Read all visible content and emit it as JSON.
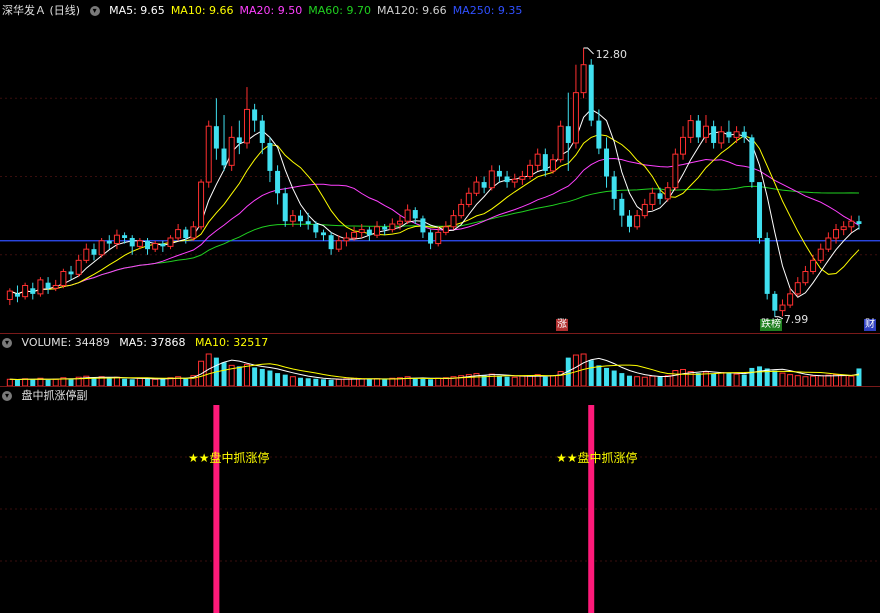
{
  "main": {
    "title": "深华发Ａ (日线)",
    "ma_labels": [
      {
        "text": "MA5: 9.65",
        "color": "#ffffff"
      },
      {
        "text": "MA10: 9.66",
        "color": "#ffff00"
      },
      {
        "text": "MA20: 9.50",
        "color": "#ff40ff"
      },
      {
        "text": "MA60: 9.70",
        "color": "#20d020"
      },
      {
        "text": "MA120: 9.66",
        "color": "#d0d0d0"
      },
      {
        "text": "MA250: 9.35",
        "color": "#3050ff"
      }
    ],
    "high_label": "12.80",
    "low_label": "7.99",
    "markers": [
      {
        "text": "涨",
        "color": "#b03030"
      },
      {
        "text": "跌榜",
        "color": "#208020"
      },
      {
        "text": "财",
        "color": "#3040c0"
      }
    ]
  },
  "volume": {
    "title": "VOLUME: 34489",
    "ma5": "MA5: 37868",
    "ma10": "MA10: 32517"
  },
  "indicator": {
    "title": "盘中抓涨停副",
    "signal_label": "★★盘中抓涨停"
  },
  "colors": {
    "up": "#ff3030",
    "down": "#40e0f0",
    "ma5": "#ffffff",
    "ma10": "#ffff00",
    "ma20": "#ff40ff",
    "ma60": "#20d020",
    "ma120": "#d0d0d0",
    "ma250": "#3050ff",
    "signal": "#ff1a7a"
  },
  "chart_data": {
    "type": "candlestick",
    "title": "深华发Ａ (日线)",
    "price_range": [
      7.7,
      13.3
    ],
    "extremes": {
      "high": 12.8,
      "low": 7.99
    },
    "candles": [
      [
        8.3,
        8.45,
        8.2,
        8.5
      ],
      [
        8.4,
        8.35,
        8.25,
        8.55
      ],
      [
        8.35,
        8.55,
        8.3,
        8.6
      ],
      [
        8.5,
        8.4,
        8.3,
        8.6
      ],
      [
        8.4,
        8.65,
        8.35,
        8.7
      ],
      [
        8.6,
        8.5,
        8.4,
        8.7
      ],
      [
        8.5,
        8.55,
        8.45,
        8.65
      ],
      [
        8.55,
        8.8,
        8.5,
        8.85
      ],
      [
        8.8,
        8.75,
        8.65,
        8.9
      ],
      [
        8.75,
        9.0,
        8.7,
        9.1
      ],
      [
        9.0,
        9.2,
        8.95,
        9.3
      ],
      [
        9.2,
        9.1,
        9.0,
        9.3
      ],
      [
        9.1,
        9.35,
        9.05,
        9.4
      ],
      [
        9.35,
        9.3,
        9.2,
        9.45
      ],
      [
        9.3,
        9.45,
        9.2,
        9.55
      ],
      [
        9.45,
        9.4,
        9.3,
        9.5
      ],
      [
        9.4,
        9.25,
        9.1,
        9.45
      ],
      [
        9.25,
        9.35,
        9.2,
        9.4
      ],
      [
        9.35,
        9.2,
        9.1,
        9.4
      ],
      [
        9.2,
        9.3,
        9.15,
        9.35
      ],
      [
        9.3,
        9.25,
        9.15,
        9.35
      ],
      [
        9.25,
        9.4,
        9.2,
        9.45
      ],
      [
        9.4,
        9.55,
        9.35,
        9.65
      ],
      [
        9.55,
        9.4,
        9.3,
        9.6
      ],
      [
        9.4,
        9.6,
        9.35,
        9.7
      ],
      [
        9.6,
        10.4,
        9.55,
        10.45
      ],
      [
        10.4,
        11.4,
        10.3,
        11.5
      ],
      [
        11.4,
        11.0,
        10.8,
        11.9
      ],
      [
        11.0,
        10.7,
        10.6,
        11.6
      ],
      [
        10.7,
        11.2,
        10.6,
        11.4
      ],
      [
        11.2,
        11.1,
        10.9,
        11.5
      ],
      [
        11.1,
        11.7,
        11.0,
        12.1
      ],
      [
        11.7,
        11.5,
        11.3,
        11.8
      ],
      [
        11.5,
        11.1,
        10.9,
        11.6
      ],
      [
        11.1,
        10.6,
        10.4,
        11.2
      ],
      [
        10.6,
        10.2,
        10.0,
        10.7
      ],
      [
        10.2,
        9.7,
        9.6,
        10.3
      ],
      [
        9.7,
        9.8,
        9.6,
        9.9
      ],
      [
        9.8,
        9.7,
        9.6,
        9.9
      ],
      [
        9.7,
        9.65,
        9.55,
        9.85
      ],
      [
        9.65,
        9.5,
        9.4,
        9.7
      ],
      [
        9.5,
        9.45,
        9.35,
        9.55
      ],
      [
        9.45,
        9.2,
        9.1,
        9.5
      ],
      [
        9.2,
        9.35,
        9.15,
        9.45
      ],
      [
        9.35,
        9.4,
        9.25,
        9.5
      ],
      [
        9.4,
        9.5,
        9.35,
        9.6
      ],
      [
        9.5,
        9.55,
        9.4,
        9.65
      ],
      [
        9.55,
        9.45,
        9.35,
        9.6
      ],
      [
        9.45,
        9.6,
        9.4,
        9.7
      ],
      [
        9.6,
        9.55,
        9.45,
        9.65
      ],
      [
        9.55,
        9.65,
        9.5,
        9.75
      ],
      [
        9.65,
        9.7,
        9.55,
        9.8
      ],
      [
        9.7,
        9.9,
        9.65,
        10.0
      ],
      [
        9.9,
        9.75,
        9.65,
        9.95
      ],
      [
        9.75,
        9.5,
        9.4,
        9.8
      ],
      [
        9.5,
        9.3,
        9.2,
        9.55
      ],
      [
        9.3,
        9.5,
        9.25,
        9.6
      ],
      [
        9.5,
        9.6,
        9.45,
        9.7
      ],
      [
        9.6,
        9.8,
        9.55,
        9.9
      ],
      [
        9.8,
        10.0,
        9.75,
        10.1
      ],
      [
        10.0,
        10.2,
        9.95,
        10.3
      ],
      [
        10.2,
        10.4,
        10.15,
        10.5
      ],
      [
        10.4,
        10.3,
        10.2,
        10.5
      ],
      [
        10.3,
        10.6,
        10.25,
        10.7
      ],
      [
        10.6,
        10.5,
        10.4,
        10.7
      ],
      [
        10.5,
        10.4,
        10.3,
        10.6
      ],
      [
        10.4,
        10.45,
        10.3,
        10.55
      ],
      [
        10.45,
        10.5,
        10.35,
        10.6
      ],
      [
        10.5,
        10.7,
        10.45,
        10.8
      ],
      [
        10.7,
        10.9,
        10.6,
        11.0
      ],
      [
        10.9,
        10.6,
        10.5,
        11.0
      ],
      [
        10.6,
        10.8,
        10.55,
        10.9
      ],
      [
        10.8,
        11.4,
        10.75,
        11.5
      ],
      [
        11.4,
        11.1,
        10.6,
        12.0
      ],
      [
        11.1,
        12.0,
        11.0,
        12.5
      ],
      [
        12.0,
        12.5,
        11.9,
        12.8
      ],
      [
        12.5,
        11.5,
        11.4,
        12.6
      ],
      [
        11.5,
        11.0,
        10.9,
        11.7
      ],
      [
        11.0,
        10.5,
        10.3,
        11.2
      ],
      [
        10.5,
        10.1,
        9.9,
        10.6
      ],
      [
        10.1,
        9.8,
        9.6,
        10.2
      ],
      [
        9.8,
        9.6,
        9.5,
        9.9
      ],
      [
        9.6,
        9.8,
        9.55,
        9.9
      ],
      [
        9.8,
        10.0,
        9.75,
        10.1
      ],
      [
        10.0,
        10.2,
        9.9,
        10.3
      ],
      [
        10.2,
        10.1,
        10.0,
        10.3
      ],
      [
        10.1,
        10.3,
        10.05,
        10.4
      ],
      [
        10.3,
        10.9,
        10.25,
        11.0
      ],
      [
        10.9,
        11.2,
        10.8,
        11.4
      ],
      [
        11.2,
        11.5,
        11.1,
        11.6
      ],
      [
        11.5,
        11.2,
        11.1,
        11.6
      ],
      [
        11.2,
        11.4,
        11.1,
        11.6
      ],
      [
        11.4,
        11.1,
        11.0,
        11.5
      ],
      [
        11.1,
        11.3,
        11.0,
        11.4
      ],
      [
        11.3,
        11.2,
        11.1,
        11.5
      ],
      [
        11.2,
        11.3,
        11.1,
        11.4
      ],
      [
        11.3,
        11.2,
        11.1,
        11.4
      ],
      [
        11.2,
        10.4,
        10.3,
        11.25
      ],
      [
        10.4,
        9.4,
        9.3,
        10.0
      ],
      [
        9.4,
        8.4,
        8.3,
        9.5
      ],
      [
        8.4,
        8.1,
        7.99,
        8.45
      ],
      [
        8.1,
        8.2,
        8.0,
        8.3
      ],
      [
        8.2,
        8.4,
        8.15,
        8.5
      ],
      [
        8.4,
        8.6,
        8.35,
        8.7
      ],
      [
        8.6,
        8.8,
        8.55,
        8.9
      ],
      [
        8.8,
        9.0,
        8.75,
        9.1
      ],
      [
        9.0,
        9.2,
        8.95,
        9.3
      ],
      [
        9.2,
        9.4,
        9.15,
        9.5
      ],
      [
        9.4,
        9.55,
        9.3,
        9.65
      ],
      [
        9.55,
        9.6,
        9.45,
        9.7
      ],
      [
        9.6,
        9.7,
        9.5,
        9.8
      ],
      [
        9.7,
        9.65,
        9.55,
        9.8
      ]
    ],
    "volume": [
      13,
      12,
      14,
      13,
      15,
      12,
      13,
      16,
      14,
      17,
      19,
      16,
      18,
      15,
      17,
      14,
      13,
      15,
      14,
      13,
      14,
      16,
      18,
      15,
      20,
      48,
      62,
      55,
      46,
      40,
      38,
      42,
      36,
      33,
      30,
      25,
      22,
      18,
      16,
      15,
      14,
      13,
      12,
      13,
      14,
      15,
      14,
      13,
      14,
      13,
      15,
      16,
      18,
      15,
      14,
      13,
      15,
      16,
      18,
      20,
      22,
      24,
      21,
      23,
      20,
      18,
      17,
      19,
      20,
      22,
      18,
      20,
      28,
      55,
      60,
      62,
      50,
      40,
      35,
      30,
      25,
      20,
      18,
      17,
      19,
      18,
      20,
      30,
      32,
      28,
      25,
      27,
      24,
      26,
      25,
      23,
      22,
      35,
      38,
      34,
      30,
      25,
      22,
      20,
      18,
      19,
      20,
      21,
      22,
      20,
      19,
      34
    ],
    "volume_range": [
      0,
      62
    ],
    "signals": [
      27,
      76
    ],
    "moving_average_periods": [
      5,
      10,
      20,
      60,
      120,
      250
    ]
  }
}
